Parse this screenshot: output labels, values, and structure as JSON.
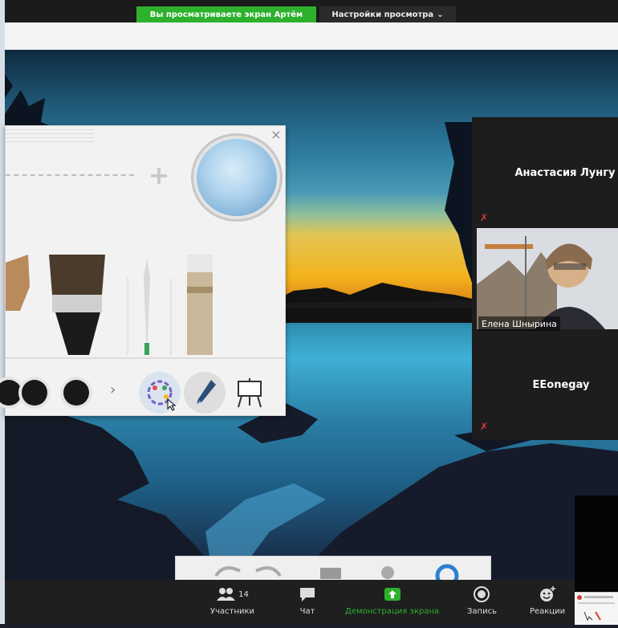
{
  "share_banner": {
    "text": "Вы просматриваете экран Артём"
  },
  "view_settings": {
    "label": "Настройки просмотра",
    "chevron": "⌄"
  },
  "panel": {
    "close": "×"
  },
  "participants": [
    {
      "name": "Анастасия Лунгу",
      "has_video": false,
      "muted": true
    },
    {
      "name": "Елена Шнырина",
      "has_video": true,
      "muted": false
    },
    {
      "name": "EEonegay",
      "has_video": false,
      "muted": true
    }
  ],
  "toolbar": {
    "participants_label": "Участники",
    "participants_count": "14",
    "chat_label": "Чат",
    "share_label": "Демонстрация экрана",
    "record_label": "Запись",
    "reactions_label": "Реакции",
    "share_color": "#2db12d"
  },
  "icons": [
    "user-group-icon",
    "chat-bubble-icon",
    "share-screen-icon",
    "record-icon",
    "smiley-icon",
    "brush-icon",
    "plus-icon",
    "palette-icon",
    "pen-icon",
    "easel-icon",
    "muted-mic-icon"
  ]
}
